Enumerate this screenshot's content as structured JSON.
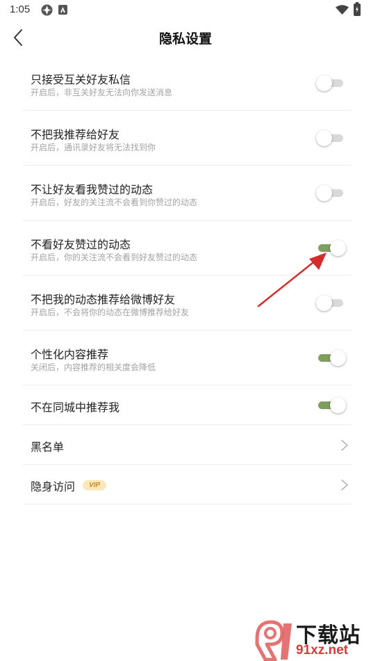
{
  "status_bar": {
    "time": "1:05"
  },
  "header": {
    "title": "隐私设置"
  },
  "settings": [
    {
      "title": "只接受互关好友私信",
      "subtitle": "开启后，非互关好友无法向你发送消息",
      "toggle_on": false
    },
    {
      "title": "不把我推荐给好友",
      "subtitle": "开启后，通讯录好友将无法找到你",
      "toggle_on": false
    },
    {
      "title": "不让好友看我赞过的动态",
      "subtitle": "开启后，好友的关注流不会看到你赞过的动态",
      "toggle_on": false
    },
    {
      "title": "不看好友赞过的动态",
      "subtitle": "开启后，你的关注流不会看到好友赞过的动态",
      "toggle_on": true
    },
    {
      "title": "不把我的动态推荐给微博好友",
      "subtitle": "开启后，不会将你的动态在微博推荐给好友",
      "toggle_on": false
    },
    {
      "title": "个性化内容推荐",
      "subtitle": "关闭后，内容推荐的相关度会降低",
      "toggle_on": true
    },
    {
      "title": "不在同城中推荐我",
      "toggle_on": true
    }
  ],
  "links": {
    "blacklist": "黑名单",
    "stealth_visit": "隐身访问",
    "vip_badge": "VIP"
  },
  "watermark": {
    "title": "下载站",
    "url": "91xz.net"
  },
  "colors": {
    "toggle_on": "#7f9e5f",
    "toggle_off": "#d9d9d9",
    "annotation_arrow": "#d42b2b"
  }
}
